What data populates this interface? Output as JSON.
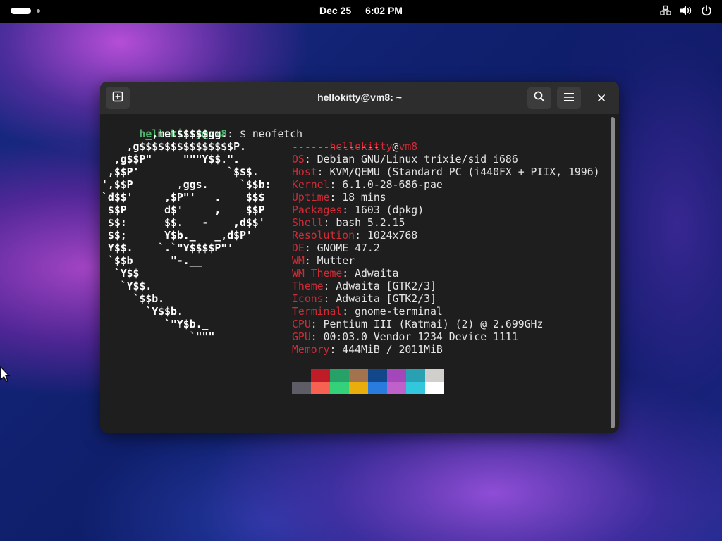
{
  "topbar": {
    "date": "Dec 25",
    "time": "6:02 PM",
    "icons": [
      "activities-pill",
      "network-icon",
      "volume-icon",
      "power-icon"
    ]
  },
  "window": {
    "title": "hellokitty@vm8: ~",
    "buttons": [
      "new-tab-icon",
      "search-icon",
      "menu-icon",
      "close-icon"
    ]
  },
  "terminal": {
    "prompt_user": "hellokitty@vm8",
    "prompt_suffix": ": $ ",
    "command": "neofetch",
    "logo_lines": [
      "       _,met$$$$$gg.",
      "    ,g$$$$$$$$$$$$$$$P.",
      "  ,g$$P\"     \"\"\"Y$$.\".",
      " ,$$P'              `$$$.",
      "',$$P       ,ggs.     `$$b:",
      "`d$$'     ,$P\"'   .    $$$",
      " $$P      d$'     ,    $$P",
      " $$:      $$.   -    ,d$$'",
      " $$;      Y$b._   _,d$P'",
      " Y$$.    `.`\"Y$$$$P\"'",
      " `$$b      \"-.__",
      "  `Y$$",
      "   `Y$$.",
      "     `$$b.",
      "       `Y$$b.",
      "          `\"Y$b._",
      "              `\"\"\""
    ],
    "header_user": "hellokitty",
    "header_at": "@",
    "header_host": "vm8",
    "separator": "--------------",
    "info": [
      {
        "key": "OS",
        "value": "Debian GNU/Linux trixie/sid i686"
      },
      {
        "key": "Host",
        "value": "KVM/QEMU (Standard PC (i440FX + PIIX, 1996)"
      },
      {
        "key": "Kernel",
        "value": "6.1.0-28-686-pae"
      },
      {
        "key": "Uptime",
        "value": "18 mins"
      },
      {
        "key": "Packages",
        "value": "1603 (dpkg)"
      },
      {
        "key": "Shell",
        "value": "bash 5.2.15"
      },
      {
        "key": "Resolution",
        "value": "1024x768"
      },
      {
        "key": "DE",
        "value": "GNOME 47.2"
      },
      {
        "key": "WM",
        "value": "Mutter"
      },
      {
        "key": "WM Theme",
        "value": "Adwaita"
      },
      {
        "key": "Theme",
        "value": "Adwaita [GTK2/3]"
      },
      {
        "key": "Icons",
        "value": "Adwaita [GTK2/3]"
      },
      {
        "key": "Terminal",
        "value": "gnome-terminal"
      },
      {
        "key": "CPU",
        "value": "Pentium III (Katmai) (2) @ 2.699GHz"
      },
      {
        "key": "GPU",
        "value": "00:03.0 Vendor 1234 Device 1111"
      },
      {
        "key": "Memory",
        "value": "444MiB / 2011MiB"
      }
    ],
    "palette_row1": [
      "#1e1e1e",
      "#c01c28",
      "#26a269",
      "#a2734c",
      "#12488b",
      "#a347ba",
      "#2aa1b3",
      "#d0cfcc"
    ],
    "palette_row2": [
      "#5e5c64",
      "#f66151",
      "#33d17a",
      "#e9ad0c",
      "#2a7bde",
      "#c061cb",
      "#33c7de",
      "#ffffff"
    ]
  },
  "colors": {
    "prompt_green": "#4fb36a",
    "debian_red": "#d12b36",
    "terminal_bg": "#1e1e1e",
    "headerbar_bg": "#2d2d2d"
  }
}
